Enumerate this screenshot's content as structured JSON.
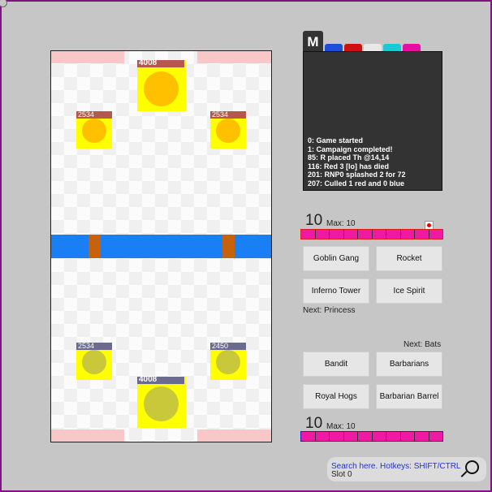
{
  "colors": {
    "background": "#c6c6c6",
    "frame": "#7e157e",
    "river": "#1a7ef5",
    "bridge": "#c5620b",
    "tower": "#ffff00",
    "red_tower_core": "#ffc000",
    "blue_tower_core": "#c8c83a",
    "red_hp_bar": "#b7584f",
    "blue_hp_bar": "#6b6b8f",
    "elixir": "#f01aa2"
  },
  "arena": {
    "enemy_towers": {
      "king": {
        "hp": "4008"
      },
      "left_princess": {
        "hp": "2534"
      },
      "right_princess": {
        "hp": "2534"
      }
    },
    "player_towers": {
      "king": {
        "hp": "4008"
      },
      "left_princess": {
        "hp": "2534"
      },
      "right_princess": {
        "hp": "2450"
      }
    }
  },
  "menu_button": {
    "label": "M"
  },
  "toolbar_icons": [
    "arrow-icon",
    "red-arrow-icon",
    "paint-brush-icon",
    "cyan-circle-icon",
    "pink-send-icon"
  ],
  "log": {
    "lines": [
      "0: Game started",
      "1: Campaign completed!",
      "85: R placed Th @14,14",
      "116: Red 3 [lo] has died",
      "201: RNP0 splashed 2 for 72",
      "207: Culled 1 red and 0 blue"
    ]
  },
  "red": {
    "elixir": "10",
    "max_label": "Max: 10",
    "elixir_fraction": 1.0,
    "cards": [
      "Goblin Gang",
      "Rocket",
      "Inferno Tower",
      "Ice Spirit"
    ],
    "next_label": "Next: Princess"
  },
  "blue": {
    "next_label": "Next: Bats",
    "cards": [
      "Bandit",
      "Barbarians",
      "Royal Hogs",
      "Barbarian Barrel"
    ],
    "elixir": "10",
    "max_label": "Max: 10",
    "elixir_fraction": 1.0
  },
  "search": {
    "placeholder": "Search here. Hotkeys: SHIFT/CTRL",
    "slot": "Slot 0"
  }
}
